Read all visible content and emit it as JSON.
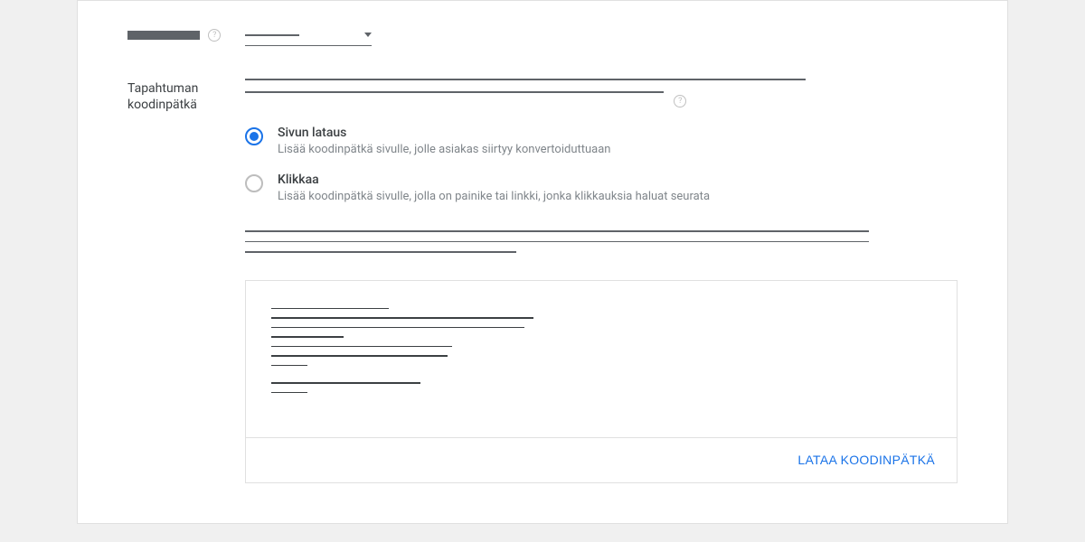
{
  "top_field": {
    "label_placeholder": true,
    "help_tooltip": "?"
  },
  "section": {
    "label_line1": "Tapahtuman",
    "label_line2": "koodinpätkä",
    "help_tooltip": "?"
  },
  "radio_options": [
    {
      "key": "page_load",
      "title": "Sivun lataus",
      "description": "Lisää koodinpätkä sivulle, jolle asiakas siirtyy konvertoiduttuaan",
      "selected": true
    },
    {
      "key": "click",
      "title": "Klikkaa",
      "description": "Lisää koodinpätkä sivulle, jolla on painike tai linkki, jonka klikkauksia haluat seurata",
      "selected": false
    }
  ],
  "code_box": {
    "download_button": "LATAA KOODINPÄTKÄ"
  }
}
